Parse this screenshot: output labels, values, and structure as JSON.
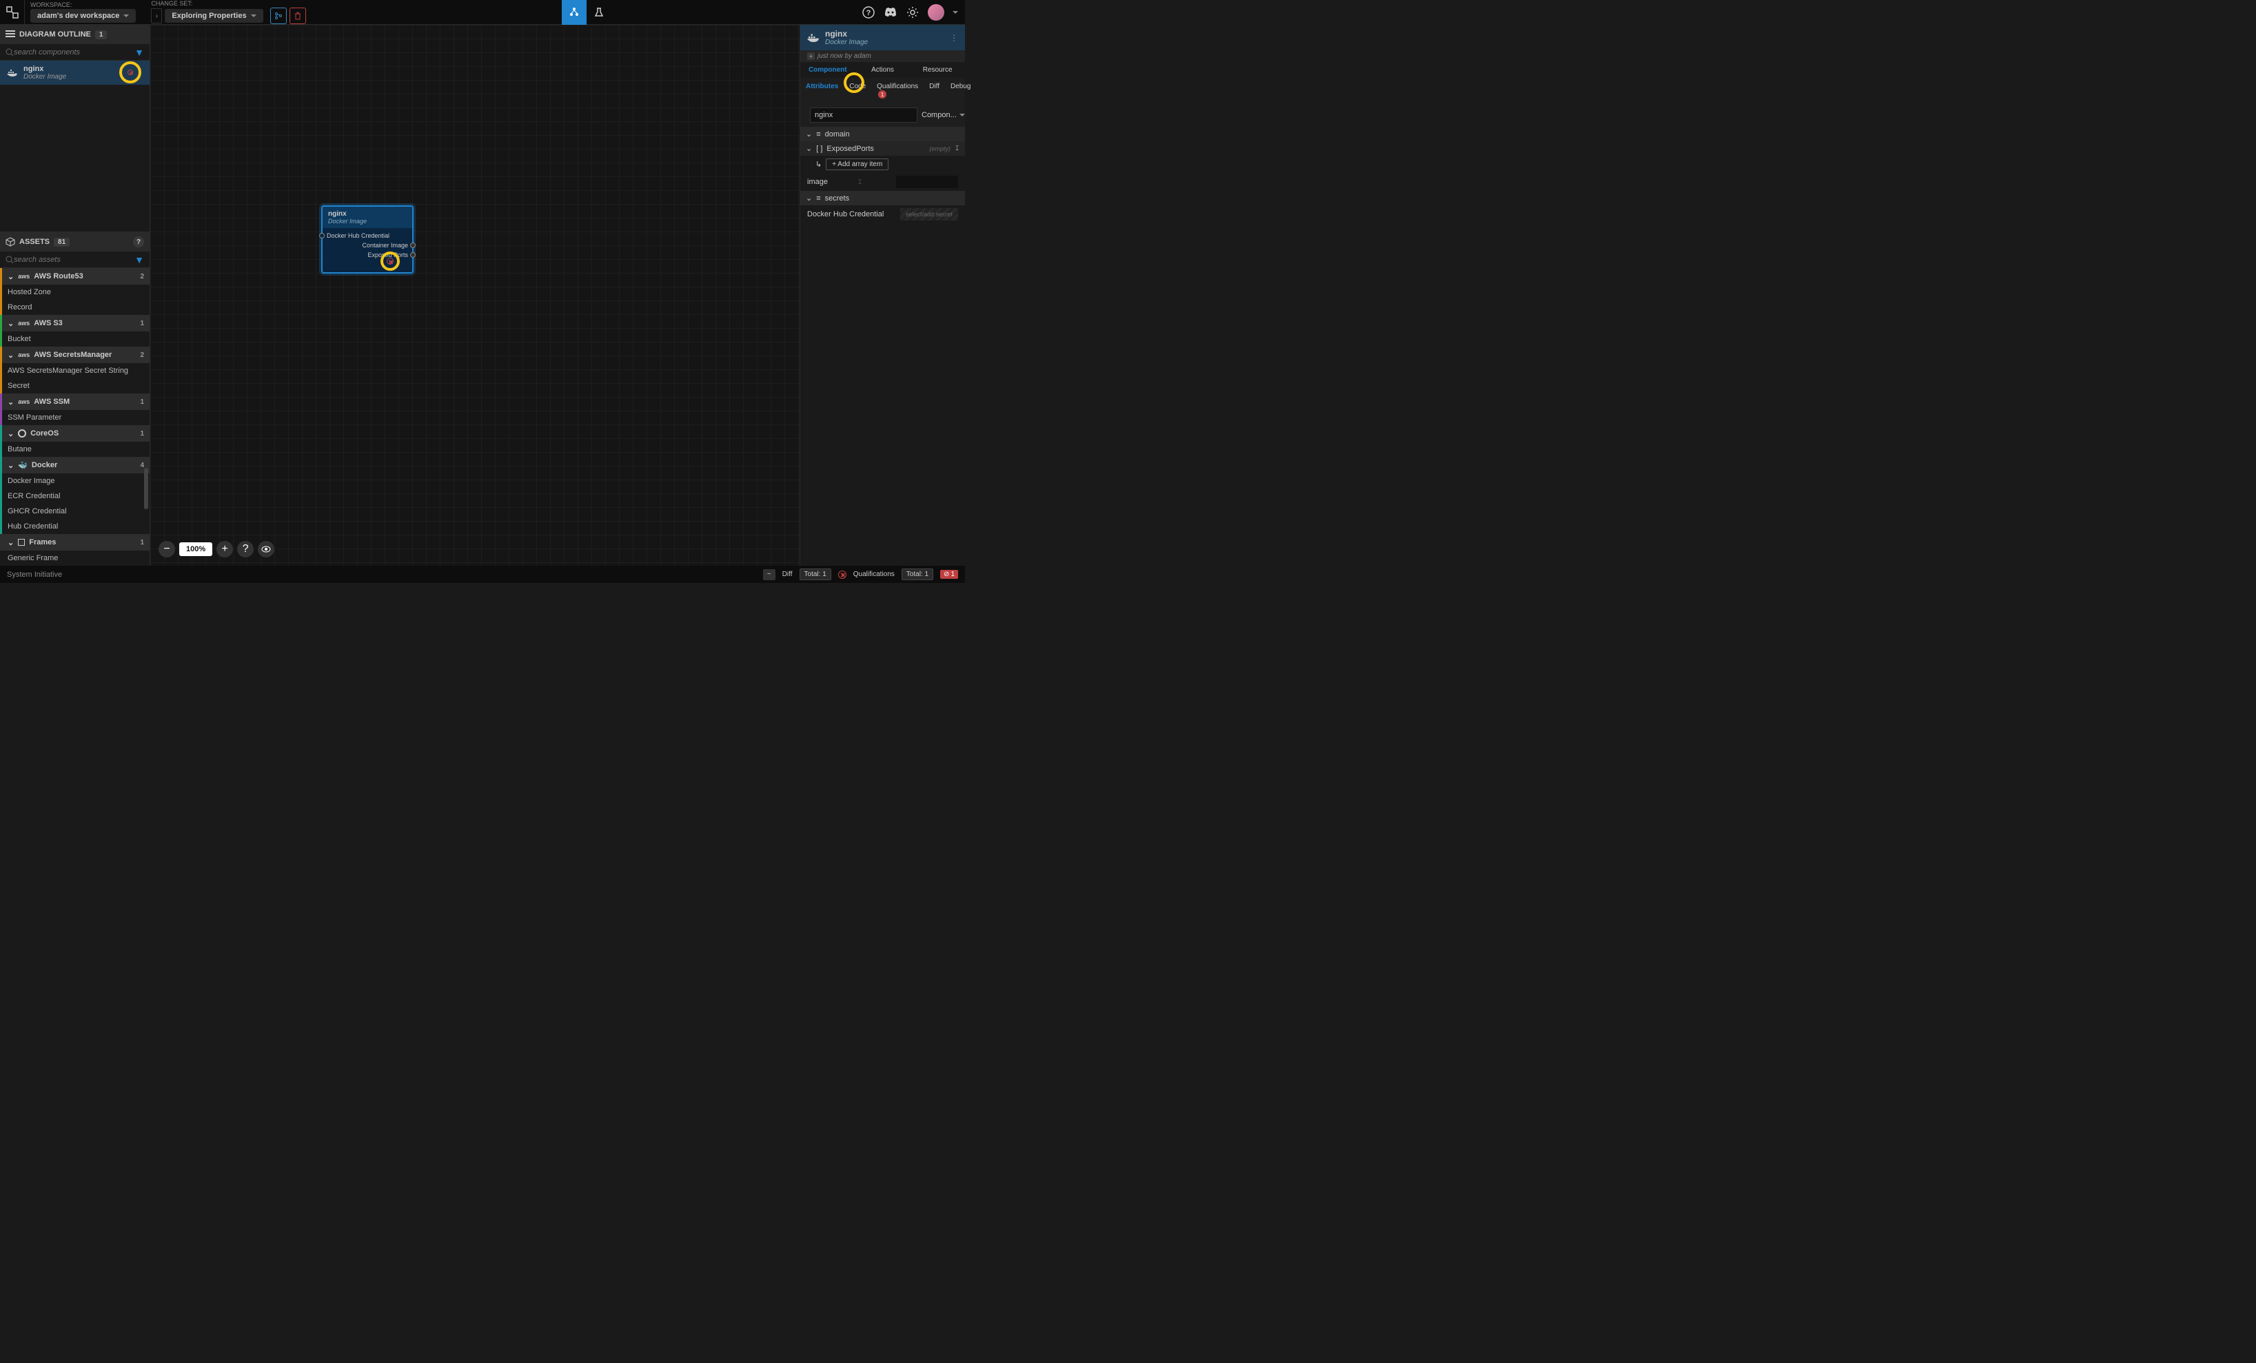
{
  "topbar": {
    "workspace_label": "WORKSPACE:",
    "workspace_value": "adam's dev workspace",
    "changeset_label": "CHANGE SET:",
    "changeset_value": "Exploring Properties"
  },
  "outline": {
    "title": "DIAGRAM OUTLINE",
    "count": "1",
    "search_placeholder": "search components",
    "item": {
      "name": "nginx",
      "type": "Docker Image"
    }
  },
  "assets": {
    "title": "ASSETS",
    "count": "81",
    "search_placeholder": "search assets",
    "categories": [
      {
        "name": "AWS Route53",
        "count": "2",
        "border": "border-orange",
        "items": [
          "Hosted Zone",
          "Record"
        ]
      },
      {
        "name": "AWS S3",
        "count": "1",
        "border": "border-green",
        "items": [
          "Bucket"
        ]
      },
      {
        "name": "AWS SecretsManager",
        "count": "2",
        "border": "border-orange",
        "items": [
          "AWS SecretsManager Secret String",
          "Secret"
        ]
      },
      {
        "name": "AWS SSM",
        "count": "1",
        "border": "border-purple",
        "items": [
          "SSM Parameter"
        ]
      },
      {
        "name": "CoreOS",
        "count": "1",
        "border": "border-teal",
        "items": [
          "Butane"
        ]
      },
      {
        "name": "Docker",
        "count": "4",
        "border": "border-teal",
        "items": [
          "Docker Image",
          "ECR Credential",
          "GHCR Credential",
          "Hub Credential"
        ]
      },
      {
        "name": "Frames",
        "count": "1",
        "border": "",
        "items": [
          "Generic Frame"
        ]
      }
    ]
  },
  "node": {
    "name": "nginx",
    "type": "Docker Image",
    "input": "Docker Hub Credential",
    "outputs": [
      "Container Image",
      "Exposed Ports"
    ]
  },
  "zoom": {
    "value": "100%"
  },
  "right": {
    "name": "nginx",
    "type": "Docker Image",
    "timestamp": "just now by adam",
    "tabs": [
      "Component",
      "Actions",
      "Resource"
    ],
    "subtabs": [
      {
        "label": "Attributes",
        "active": true
      },
      {
        "label": "Code"
      },
      {
        "label": "Qualifications",
        "badge": "1"
      },
      {
        "label": "Diff"
      },
      {
        "label": "Debug"
      }
    ],
    "name_input": "nginx",
    "type_select": "Compon...",
    "domain_label": "domain",
    "exposed_ports_label": "ExposedPorts",
    "exposed_ports_hint": "(empty)",
    "add_item": "+  Add array item",
    "image_label": "image",
    "secrets_label": "secrets",
    "docker_hub_label": "Docker Hub Credential",
    "secret_placeholder": "select/add secret"
  },
  "footer": {
    "brand": "System Initiative",
    "diff": "Diff",
    "total1": "Total:  1",
    "qualifications": "Qualifications",
    "total2": "Total:  1",
    "err_count": "1"
  }
}
